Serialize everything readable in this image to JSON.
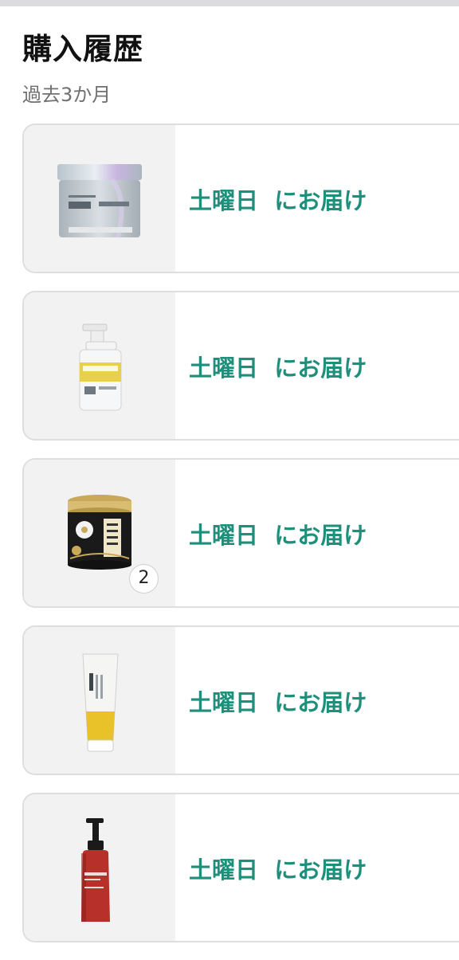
{
  "header": {
    "title": "購入履歴",
    "subtitle": "過去3か月"
  },
  "colors": {
    "accent": "#1f8f7b",
    "thumb_bg": "#f2f2f2",
    "border": "#dedede"
  },
  "orders": [
    {
      "delivery_text": "土曜日  にお届け",
      "product_icon": "hair-mask-jar-icon",
      "quantity": null
    },
    {
      "delivery_text": "土曜日  にお届け",
      "product_icon": "body-wash-pump-bottle-icon",
      "quantity": null
    },
    {
      "delivery_text": "土曜日  にお届け",
      "product_icon": "cotton-swab-tin-icon",
      "quantity": "2"
    },
    {
      "delivery_text": "土曜日  にお届け",
      "product_icon": "cream-tube-icon",
      "quantity": null
    },
    {
      "delivery_text": "土曜日  にお届け",
      "product_icon": "lotion-pump-bottle-icon",
      "quantity": null
    }
  ]
}
